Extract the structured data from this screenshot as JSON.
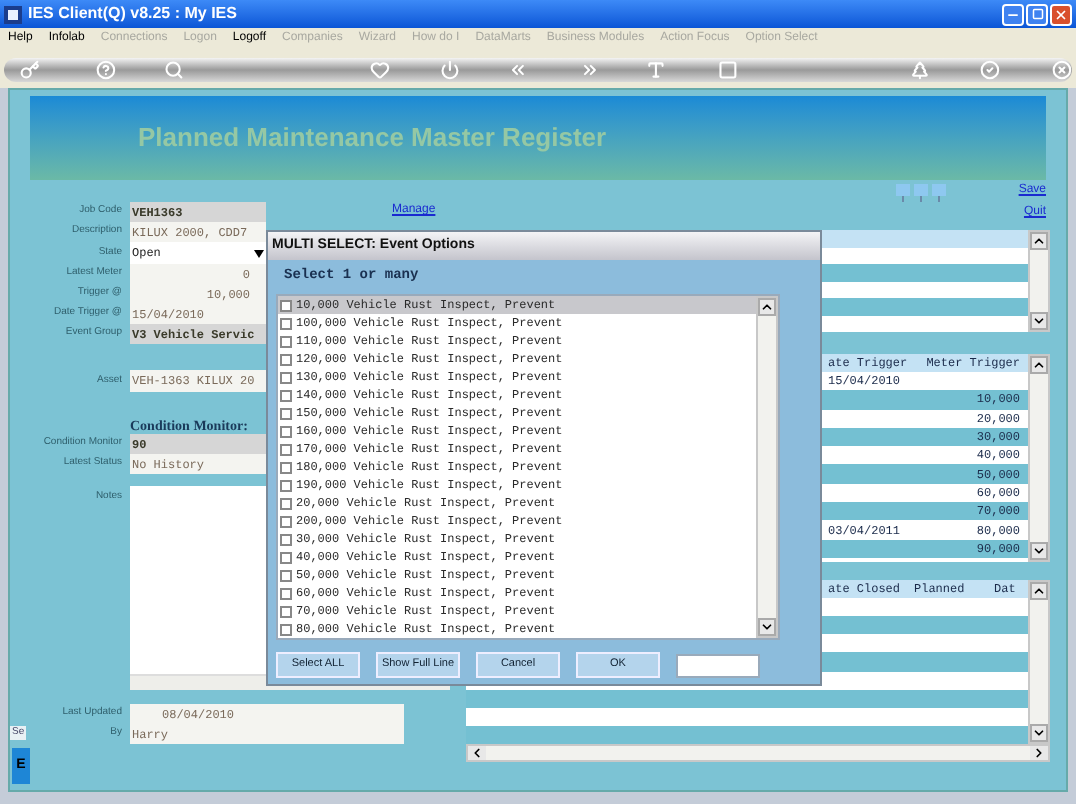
{
  "window": {
    "title": "IES Client(Q) v8.25 : My IES"
  },
  "menu": [
    {
      "label": "Help",
      "disabled": false
    },
    {
      "label": "Infolab",
      "disabled": false
    },
    {
      "label": "Connections",
      "disabled": true
    },
    {
      "label": "Logon",
      "disabled": true
    },
    {
      "label": "Logoff",
      "disabled": false
    },
    {
      "label": "Companies",
      "disabled": true
    },
    {
      "label": "Wizard",
      "disabled": true
    },
    {
      "label": "How do I",
      "disabled": true
    },
    {
      "label": "DataMarts",
      "disabled": true
    },
    {
      "label": "Business Modules",
      "disabled": true
    },
    {
      "label": "Action Focus",
      "disabled": true
    },
    {
      "label": "Option Select",
      "disabled": true
    }
  ],
  "header": {
    "title": "Planned Maintenance Master Register"
  },
  "manage_link": "Manage",
  "form": {
    "fields": [
      {
        "label": "Job Code",
        "value": "VEH1363",
        "kind": "key"
      },
      {
        "label": "Description",
        "value": "KILUX 2000, CDD7",
        "kind": "text"
      },
      {
        "label": "State",
        "value": "Open",
        "kind": "dropdown"
      },
      {
        "label": "Latest Meter",
        "value": "0",
        "kind": "number"
      },
      {
        "label": "Trigger @",
        "value": "10,000",
        "kind": "number"
      },
      {
        "label": "Date Trigger @",
        "value": "15/04/2010",
        "kind": "text"
      },
      {
        "label": "Event Group",
        "value": "V3 Vehicle Servic",
        "kind": "key"
      }
    ],
    "asset": {
      "label": "Asset",
      "value": "VEH-1363 KILUX 20"
    },
    "condition_heading": "Condition Monitor:",
    "condition_fields": [
      {
        "label": "Condition Monitor",
        "value": "90",
        "kind": "key"
      },
      {
        "label": "Latest Status",
        "value": "No History",
        "kind": "text"
      }
    ],
    "notes": {
      "label": "Notes"
    },
    "footer_fields": [
      {
        "label": "Last Updated",
        "value": "08/04/2010",
        "kind": "date"
      },
      {
        "label": "By",
        "value": "Harry",
        "kind": "text"
      }
    ]
  },
  "side_tab": "Se",
  "side_button": "E",
  "links": [
    "Save",
    "Quit"
  ],
  "trigger_grid": {
    "columns": [
      "ate Trigger",
      "Meter Trigger"
    ],
    "rows": [
      [
        "15/04/2010",
        ""
      ],
      [
        "",
        "10,000"
      ],
      [
        "",
        "20,000"
      ],
      [
        "",
        "30,000"
      ],
      [
        "",
        "40,000"
      ],
      [
        "",
        "50,000"
      ],
      [
        "",
        "60,000"
      ],
      [
        "",
        "70,000"
      ],
      [
        "03/04/2011",
        "80,000"
      ],
      [
        "",
        "90,000"
      ]
    ]
  },
  "history_grid": {
    "columns": [
      "ate Closed",
      "Planned",
      "Dat"
    ]
  },
  "dialog": {
    "title": "MULTI SELECT: Event Options",
    "prompt": "Select 1 or many",
    "options": [
      {
        "label": "10,000 Vehicle Rust Inspect, Prevent",
        "checked": false,
        "selected": true
      },
      {
        "label": "100,000 Vehicle Rust Inspect, Prevent",
        "checked": false,
        "selected": false
      },
      {
        "label": "110,000 Vehicle Rust Inspect, Prevent",
        "checked": false,
        "selected": false
      },
      {
        "label": "120,000 Vehicle Rust Inspect, Prevent",
        "checked": false,
        "selected": false
      },
      {
        "label": "130,000 Vehicle Rust Inspect, Prevent",
        "checked": false,
        "selected": false
      },
      {
        "label": "140,000 Vehicle Rust Inspect, Prevent",
        "checked": false,
        "selected": false
      },
      {
        "label": "150,000 Vehicle Rust Inspect, Prevent",
        "checked": false,
        "selected": false
      },
      {
        "label": "160,000 Vehicle Rust Inspect, Prevent",
        "checked": false,
        "selected": false
      },
      {
        "label": "170,000 Vehicle Rust Inspect, Prevent",
        "checked": false,
        "selected": false
      },
      {
        "label": "180,000 Vehicle Rust Inspect, Prevent",
        "checked": false,
        "selected": false
      },
      {
        "label": "190,000 Vehicle Rust Inspect, Prevent",
        "checked": false,
        "selected": false
      },
      {
        "label": "20,000 Vehicle Rust Inspect, Prevent",
        "checked": false,
        "selected": false
      },
      {
        "label": "200,000 Vehicle Rust Inspect, Prevent",
        "checked": false,
        "selected": false
      },
      {
        "label": "30,000 Vehicle Rust Inspect, Prevent",
        "checked": false,
        "selected": false
      },
      {
        "label": "40,000 Vehicle Rust Inspect, Prevent",
        "checked": false,
        "selected": false
      },
      {
        "label": "50,000 Vehicle Rust Inspect, Prevent",
        "checked": false,
        "selected": false
      },
      {
        "label": "60,000 Vehicle Rust Inspect, Prevent",
        "checked": false,
        "selected": false
      },
      {
        "label": "70,000 Vehicle Rust Inspect, Prevent",
        "checked": false,
        "selected": false
      },
      {
        "label": "80,000 Vehicle Rust Inspect, Prevent",
        "checked": false,
        "selected": false
      }
    ],
    "buttons": [
      "Select ALL",
      "Show Full Line",
      "Cancel",
      "OK"
    ]
  }
}
